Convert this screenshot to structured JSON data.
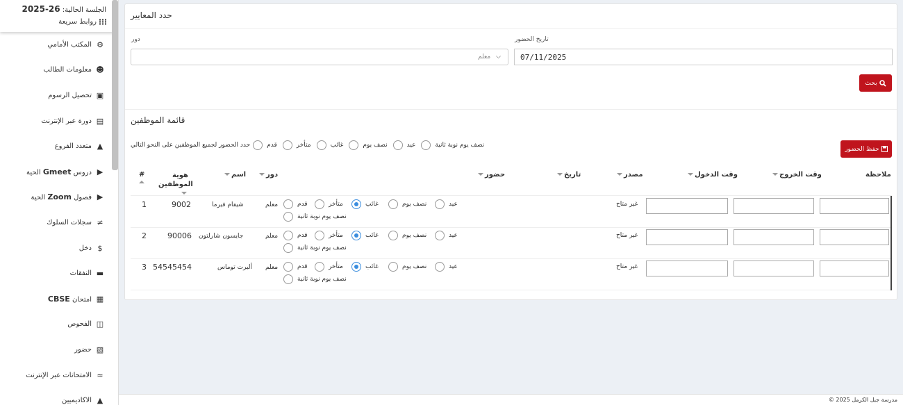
{
  "sidebar": {
    "session_label": "الجلسة الحالية:",
    "session_value": "2025-26",
    "quick_links": "روابط سريعة",
    "items": [
      {
        "label": "المكتب الأمامي",
        "icon": "front-office-icon"
      },
      {
        "label": "معلومات الطالب",
        "icon": "student-info-icon"
      },
      {
        "label": "تحصيل الرسوم",
        "icon": "fees-icon"
      },
      {
        "label": "دورة عبر الإنترنت",
        "icon": "online-course-icon"
      },
      {
        "label": "متعدد الفروع",
        "icon": "multi-branch-icon"
      },
      {
        "label_bold": "Gmeet",
        "label_pre": "دروس ",
        "label_post": " الحية",
        "icon": "video-icon"
      },
      {
        "label_bold": "Zoom",
        "label_pre": "فصول ",
        "label_post": " الحية",
        "icon": "video-icon"
      },
      {
        "label": "سجلات السلوك",
        "icon": "behaviour-icon"
      },
      {
        "label": "دخل",
        "icon": "dollar-icon"
      },
      {
        "label": "النفقات",
        "icon": "credit-card-icon"
      },
      {
        "label_bold": "CBSE",
        "label_pre": "امتحان ",
        "label_post": "",
        "icon": "exam-icon"
      },
      {
        "label": "الفحوص",
        "icon": "map-icon"
      },
      {
        "label": "حضور",
        "icon": "calendar-icon"
      },
      {
        "label": "الامتحانات عبر الإنترنت",
        "icon": "rss-icon"
      },
      {
        "label": "الاكاديميين",
        "icon": "graduation-cap-icon"
      }
    ]
  },
  "criteria": {
    "title": "حدد المعايير",
    "date_label": "تاريخ الحضور",
    "date_value": "07/11/2025",
    "role_label": "دور",
    "role_value": "معلم",
    "search_button": "بحث"
  },
  "staff": {
    "title": "قائمة الموظفين",
    "save_button": "حفظ الحضور",
    "bulk_label": "حدد الحضور لجميع الموظفين على النحو التالي",
    "attendance_options": [
      "عيد",
      "نصف يوم",
      "غائب",
      "متأخر",
      "قدم",
      "نصف يوم نوبة ثانية"
    ],
    "columns": {
      "num": "#",
      "staff_id": "هوية الموظفين",
      "name": "اسم",
      "role": "دور",
      "attendance": "حضور",
      "date": "تاريخ",
      "source": "مصدر",
      "entry_time": "وقت الدخول",
      "exit_time": "وقت الخروج",
      "note": "ملاحظة"
    },
    "rows": [
      {
        "num": "1",
        "staff_id": "9002",
        "name": "شيفام فيرما",
        "role": "معلم",
        "selected": "غائب",
        "source": "غير متاح"
      },
      {
        "num": "2",
        "staff_id": "90006",
        "name": "جايسون شارلتون",
        "role": "معلم",
        "selected": "غائب",
        "source": "غير متاح"
      },
      {
        "num": "3",
        "staff_id": "54545454",
        "name": "ألبرت توماس",
        "role": "معلم",
        "selected": "غائب",
        "source": "غير متاح"
      }
    ]
  },
  "footer": {
    "text": "© 2025 مدرسة جبل الكرمل"
  },
  "colors": {
    "accent_red": "#c0141d",
    "radio_blue": "#3a8dde"
  }
}
